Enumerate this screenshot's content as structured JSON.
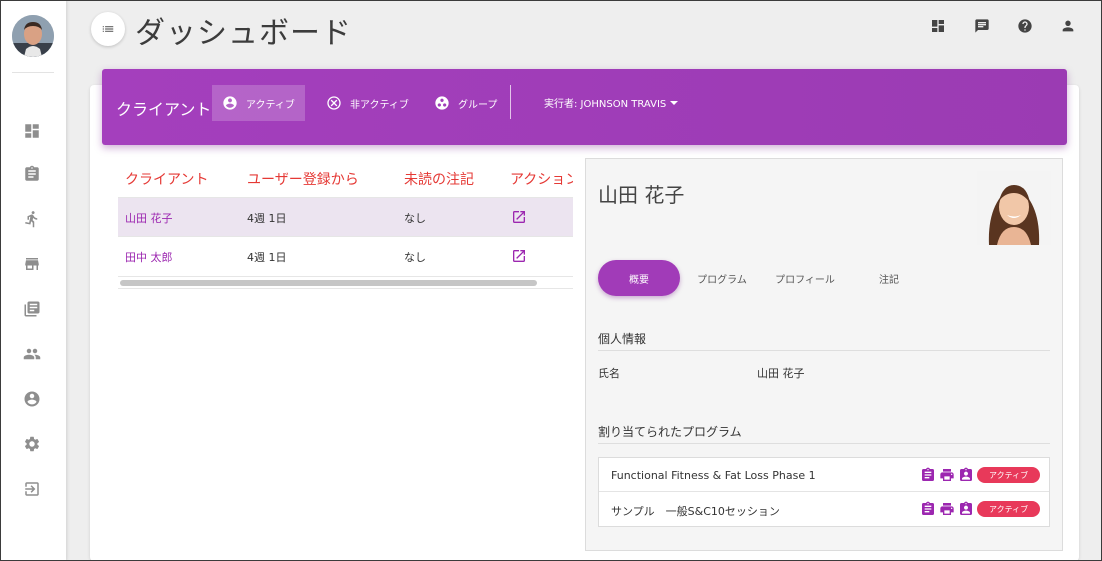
{
  "header": {
    "title": "ダッシュボード"
  },
  "topbar_icons": [
    "dashboard-icon",
    "chat-icon",
    "help-icon",
    "account-icon"
  ],
  "sidebar": {
    "icons": [
      "dashboard-icon",
      "clipboard-icon",
      "runner-icon",
      "store-icon",
      "library-icon",
      "group-icon",
      "account-circle-icon",
      "settings-icon",
      "logout-icon"
    ]
  },
  "clients_bar": {
    "title": "クライアント",
    "tabs": [
      {
        "label": "アクティブ",
        "icon": "account-circle-icon",
        "active": true
      },
      {
        "label": "非アクティブ",
        "icon": "cancel-circle-icon",
        "active": false
      },
      {
        "label": "グループ",
        "icon": "group-circle-icon",
        "active": false
      }
    ],
    "executor": "実行者: JOHNSON TRAVIS"
  },
  "table": {
    "columns": [
      "クライアント",
      "ユーザー登録から",
      "未読の注記",
      "アクション"
    ],
    "rows": [
      {
        "name": "山田 花子",
        "since": "4週 1日",
        "unread": "なし",
        "selected": true
      },
      {
        "name": "田中 太郎",
        "since": "4週 1日",
        "unread": "なし",
        "selected": false
      }
    ]
  },
  "detail": {
    "name": "山田 花子",
    "tabs": [
      "概要",
      "プログラム",
      "プロフィール",
      "注記"
    ],
    "personal_info_title": "個人情報",
    "name_label": "氏名",
    "name_value": "山田 花子",
    "programs_title": "割り当てられたプログラム",
    "programs": [
      {
        "name": "Functional Fitness & Fat Loss Phase 1",
        "status": "アクティブ"
      },
      {
        "name": "サンプル　一般S&C10セッション",
        "status": "アクティブ"
      }
    ]
  },
  "colors": {
    "accent": "#9c27b0",
    "header_purple": "#a43fbd",
    "column_header_red": "#e53935",
    "badge_red": "#e8395a"
  }
}
